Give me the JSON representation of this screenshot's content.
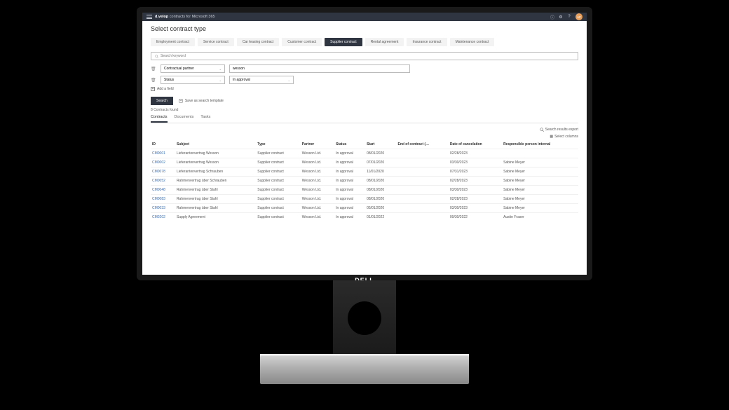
{
  "header": {
    "menu_icon": "menu",
    "app_brand": "d.velop",
    "app_name": "contracts for Microsoft 365",
    "icons": [
      "info",
      "settings",
      "help"
    ],
    "avatar_initials": "AF"
  },
  "page_title": "Select contract type",
  "contract_types": [
    {
      "label": "Employment contract",
      "active": false
    },
    {
      "label": "Service contract",
      "active": false
    },
    {
      "label": "Car leasing contract",
      "active": false
    },
    {
      "label": "Customer contract",
      "active": false
    },
    {
      "label": "Supplier contract",
      "active": true
    },
    {
      "label": "Rental agreement",
      "active": false
    },
    {
      "label": "Insurance contract",
      "active": false
    },
    {
      "label": "Maintenance contract",
      "active": false
    }
  ],
  "search": {
    "placeholder": "Search keyword",
    "value": ""
  },
  "filters": [
    {
      "field": "Contractual partner",
      "value": "wesson",
      "value_options": false
    },
    {
      "field": "Status",
      "value": "In approval",
      "value_options": true
    }
  ],
  "add_field_label": "Add a field",
  "buttons": {
    "search": "Search",
    "save_template": "Save as search template"
  },
  "results_count_label": "8 Contracts found",
  "sub_tabs": [
    {
      "label": "Contracts",
      "active": true
    },
    {
      "label": "Documents",
      "active": false
    },
    {
      "label": "Tasks",
      "active": false
    }
  ],
  "export_label": "Search results export",
  "select_columns_label": "Select columns",
  "columns": [
    "ID",
    "Subject",
    "Type",
    "Partner",
    "Status",
    "Start",
    "End of contract (…",
    "Date of cancelation",
    "Responsible person internal"
  ],
  "rows": [
    {
      "id": "CM0001",
      "subject": "Lieferantenvertrag Wesson",
      "type": "Supplier contract",
      "partner": "Wesson Ltd.",
      "status": "In approval",
      "start": "08/01/2020",
      "end": "",
      "cancel": "02/28/2023",
      "resp": ""
    },
    {
      "id": "CM0002",
      "subject": "Lieferantenvertrag Wesson",
      "type": "Supplier contract",
      "partner": "Wesson Ltd.",
      "status": "In approval",
      "start": "07/01/2020",
      "end": "",
      "cancel": "03/30/2023",
      "resp": "Sabine Meyer"
    },
    {
      "id": "CM0078",
      "subject": "Lieferantenvertrag Schrauben",
      "type": "Supplier contract",
      "partner": "Wesson Ltd.",
      "status": "In approval",
      "start": "11/01/2020",
      "end": "",
      "cancel": "07/31/2023",
      "resp": "Sabine Meyer"
    },
    {
      "id": "CM0052",
      "subject": "Rahmenvertrag über Schrauben",
      "type": "Supplier contract",
      "partner": "Wesson Ltd.",
      "status": "In approval",
      "start": "08/01/2020",
      "end": "",
      "cancel": "02/28/2023",
      "resp": "Sabine Meyer"
    },
    {
      "id": "CM0048",
      "subject": "Rahmenvertrag über Stahl",
      "type": "Supplier contract",
      "partner": "Wesson Ltd.",
      "status": "In approval",
      "start": "08/01/2020",
      "end": "",
      "cancel": "03/30/2023",
      "resp": "Sabine Meyer"
    },
    {
      "id": "CM0083",
      "subject": "Rahmenvertrag über Stahl",
      "type": "Supplier contract",
      "partner": "Wesson Ltd.",
      "status": "In approval",
      "start": "08/01/2020",
      "end": "",
      "cancel": "02/28/2023",
      "resp": "Sabine Meyer"
    },
    {
      "id": "CM0033",
      "subject": "Rahmenvertrag über Stahl",
      "type": "Supplier contract",
      "partner": "Wesson Ltd.",
      "status": "In approval",
      "start": "05/01/2020",
      "end": "",
      "cancel": "03/30/2023",
      "resp": "Sabine Meyer"
    },
    {
      "id": "CM0202",
      "subject": "Supply Agreement",
      "type": "Supplier contract",
      "partner": "Wesson Ltd.",
      "status": "In approval",
      "start": "01/01/2022",
      "end": "",
      "cancel": "09/30/2022",
      "resp": "Austin Fraser"
    }
  ],
  "monitor_brand": "DELL"
}
